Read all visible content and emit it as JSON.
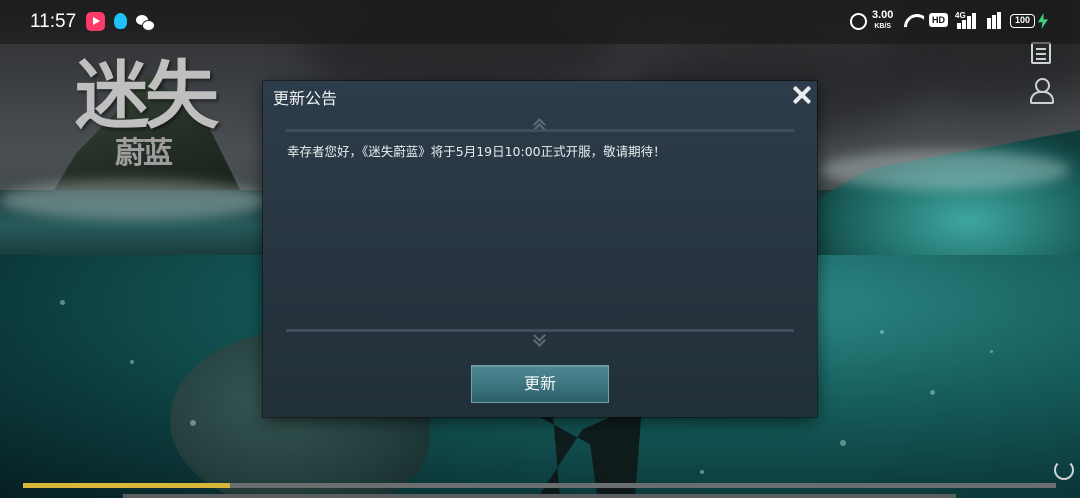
{
  "status_bar": {
    "time": "11:57",
    "net_speed_value": "3.00",
    "net_speed_unit": "KB/S",
    "hd_label": "HD",
    "network_label": "4G",
    "battery_level": "100",
    "icons": [
      "video-app-icon",
      "qq-icon",
      "wechat-icon",
      "alarm-icon",
      "wifi-icon",
      "signal-icon",
      "charge-icon"
    ]
  },
  "game": {
    "logo_main": "迷失",
    "logo_sub": "蔚蓝"
  },
  "side_icons": [
    "notice-icon",
    "user-icon"
  ],
  "dialog": {
    "title": "更新公告",
    "message": "幸存者您好，《迷失蔚蓝》将于5月19日10:00正式开服，敬请期待！",
    "update_button": "更新",
    "close_icon": "close-icon",
    "scroll_up_icon": "chevron-up-icon",
    "scroll_down_icon": "chevron-down-icon"
  },
  "loading": {
    "progress": 0.2
  },
  "colors": {
    "dialog_bg": "#2a3845",
    "button_bg": "#437c86",
    "progress_fill": "#d8b63a",
    "charge": "#3ad27a"
  }
}
